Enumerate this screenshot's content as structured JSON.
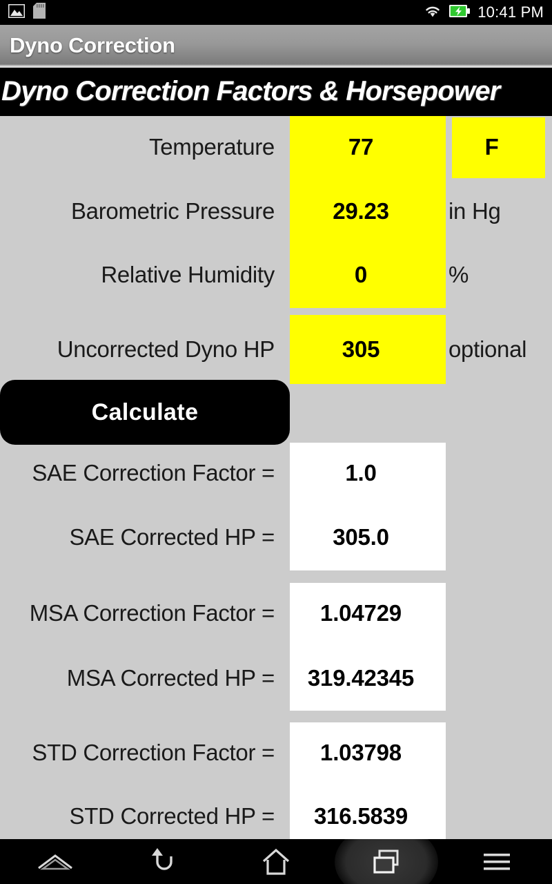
{
  "status_bar": {
    "icons": [
      "gallery-icon",
      "sd-card-icon",
      "wifi-icon",
      "battery-charging-icon"
    ],
    "clock": "10:41 PM"
  },
  "action_bar": {
    "title": "Dyno Correction"
  },
  "banner": {
    "title": "Dyno Correction Factors & Horsepower"
  },
  "inputs": {
    "temperature": {
      "label": "Temperature",
      "value": "77",
      "unit": "F"
    },
    "barometric_pressure": {
      "label": "Barometric Pressure",
      "value": "29.23",
      "unit": "in Hg"
    },
    "relative_humidity": {
      "label": "Relative Humidity",
      "value": "0",
      "unit": "%"
    },
    "uncorrected_dyno_hp": {
      "label": "Uncorrected Dyno HP",
      "value": "305",
      "unit": "optional"
    }
  },
  "actions": {
    "calculate_label": "Calculate"
  },
  "results": {
    "sae_correction_factor": {
      "label": "SAE Correction Factor =",
      "value": "1.0"
    },
    "sae_corrected_hp": {
      "label": "SAE Corrected HP =",
      "value": "305.0"
    },
    "msa_correction_factor": {
      "label": "MSA Correction Factor =",
      "value": "1.04729"
    },
    "msa_corrected_hp": {
      "label": "MSA Corrected HP =",
      "value": "319.42345"
    },
    "std_correction_factor": {
      "label": "STD Correction Factor =",
      "value": "1.03798"
    },
    "std_corrected_hp": {
      "label": "STD Corrected HP =",
      "value": "316.5839"
    }
  },
  "nav_bar": {
    "buttons": [
      {
        "name": "collapse-navbar-icon",
        "active": false
      },
      {
        "name": "back-icon",
        "active": false
      },
      {
        "name": "home-icon",
        "active": false
      },
      {
        "name": "recent-apps-icon",
        "active": true
      },
      {
        "name": "menu-icon",
        "active": false
      }
    ]
  },
  "colors": {
    "input_field": "#ffff00",
    "result_field": "#ffffff",
    "surface": "#cccccc",
    "banner": "#000000",
    "accent_button": "#000000"
  }
}
